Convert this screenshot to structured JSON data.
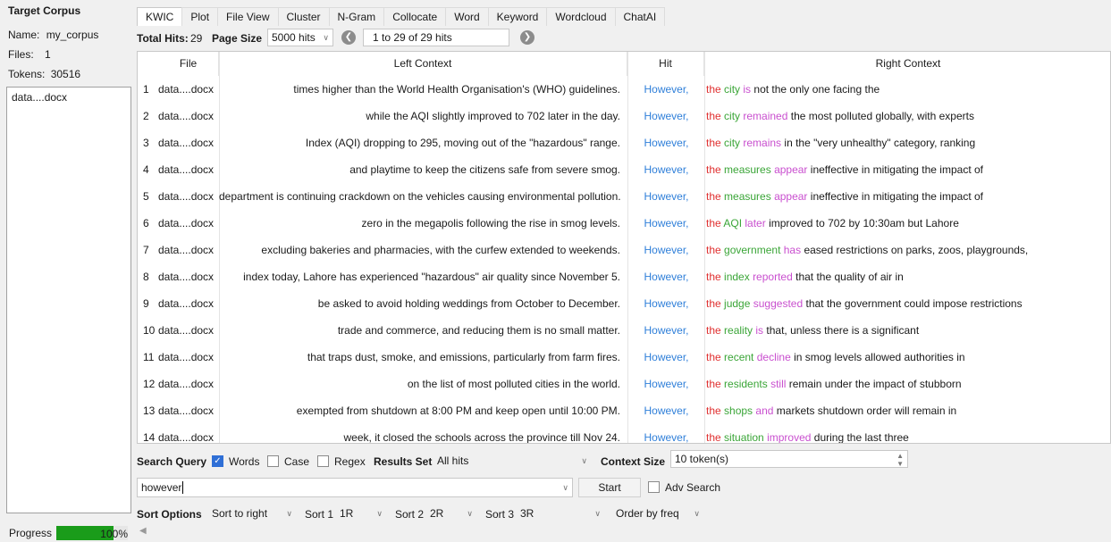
{
  "corpus": {
    "title": "Target Corpus",
    "name_label": "Name:",
    "name_value": "my_corpus",
    "files_label": "Files:",
    "files_value": "1",
    "tokens_label": "Tokens:",
    "tokens_value": "30516",
    "file_list": [
      "data....docx"
    ]
  },
  "tabs": [
    "KWIC",
    "Plot",
    "File View",
    "Cluster",
    "N-Gram",
    "Collocate",
    "Word",
    "Keyword",
    "Wordcloud",
    "ChatAI"
  ],
  "toolbar": {
    "total_hits_label": "Total Hits:",
    "total_hits_value": "29",
    "page_size_label": "Page Size",
    "page_size_value": "5000 hits",
    "range_text": "1 to 29 of 29 hits"
  },
  "table": {
    "columns": [
      "File",
      "Left Context",
      "Hit",
      "Right Context"
    ],
    "rows": [
      {
        "n": "1",
        "file": "data....docx",
        "left": "times higher than the World Health Organisation's (WHO) guidelines.",
        "hit": "However,",
        "r1": "the",
        "r2": "city",
        "r3": "is",
        "rest": "not the only one facing the"
      },
      {
        "n": "2",
        "file": "data....docx",
        "left": "while the AQI slightly improved to 702 later in the day.",
        "hit": "However,",
        "r1": "the",
        "r2": "city",
        "r3": "remained",
        "rest": "the most polluted globally, with experts"
      },
      {
        "n": "3",
        "file": "data....docx",
        "left": "Index (AQI) dropping to 295, moving out of the \"hazardous\" range.",
        "hit": "However,",
        "r1": "the",
        "r2": "city",
        "r3": "remains",
        "rest": "in the \"very unhealthy\" category, ranking"
      },
      {
        "n": "4",
        "file": "data....docx",
        "left": "and playtime to keep the citizens safe from severe smog.",
        "hit": "However,",
        "r1": "the",
        "r2": "measures",
        "r3": "appear",
        "rest": "ineffective in mitigating the impact of"
      },
      {
        "n": "5",
        "file": "data....docx",
        "left": "department is continuing crackdown on the vehicles causing environmental pollution.",
        "hit": "However,",
        "r1": "the",
        "r2": "measures",
        "r3": "appear",
        "rest": "ineffective in mitigating the impact of"
      },
      {
        "n": "6",
        "file": "data....docx",
        "left": "zero in the megapolis following the rise in smog levels.",
        "hit": "However,",
        "r1": "the",
        "r2": "AQI",
        "r3": "later",
        "rest": "improved to 702 by 10:30am but Lahore"
      },
      {
        "n": "7",
        "file": "data....docx",
        "left": "excluding bakeries and pharmacies, with the curfew extended to weekends.",
        "hit": "However,",
        "r1": "the",
        "r2": "government",
        "r3": "has",
        "rest": "eased restrictions on parks, zoos, playgrounds,"
      },
      {
        "n": "8",
        "file": "data....docx",
        "left": "index today, Lahore has experienced \"hazardous\" air quality since November 5.",
        "hit": "However,",
        "r1": "the",
        "r2": "index",
        "r3": "reported",
        "rest": "that the quality of air in"
      },
      {
        "n": "9",
        "file": "data....docx",
        "left": "be asked to avoid holding weddings from October to December.",
        "hit": "However,",
        "r1": "the",
        "r2": "judge",
        "r3": "suggested",
        "rest": "that the government could impose restrictions"
      },
      {
        "n": "10",
        "file": "data....docx",
        "left": "trade and commerce, and reducing them is no small matter.",
        "hit": "However,",
        "r1": "the",
        "r2": "reality",
        "r3": "is",
        "rest": "that, unless there is a significant"
      },
      {
        "n": "11",
        "file": "data....docx",
        "left": "that traps dust, smoke, and emissions, particularly from farm fires.",
        "hit": "However,",
        "r1": "the",
        "r2": "recent",
        "r3": "decline",
        "rest": "in smog levels allowed authorities in"
      },
      {
        "n": "12",
        "file": "data....docx",
        "left": "on the list of most polluted cities in the world.",
        "hit": "However,",
        "r1": "the",
        "r2": "residents",
        "r3": "still",
        "rest": "remain under the impact of stubborn"
      },
      {
        "n": "13",
        "file": "data....docx",
        "left": "exempted from shutdown at 8:00 PM and keep open until 10:00 PM.",
        "hit": "However,",
        "r1": "the",
        "r2": "shops",
        "r3": "and",
        "rest": "markets shutdown order will remain in"
      },
      {
        "n": "14",
        "file": "data....docx",
        "left": "week, it closed the schools across the province till Nov 24.",
        "hit": "However,",
        "r1": "the",
        "r2": "situation",
        "r3": "improved",
        "rest": "during the last three"
      }
    ]
  },
  "search": {
    "query_label": "Search Query",
    "words_label": "Words",
    "case_label": "Case",
    "regex_label": "Regex",
    "results_set_label": "Results Set",
    "results_set_value": "All hits",
    "context_size_label": "Context Size",
    "context_size_value": "10 token(s)",
    "query_value": "however",
    "start_label": "Start",
    "adv_search_label": "Adv Search"
  },
  "sort": {
    "label": "Sort Options",
    "mode_value": "Sort to right",
    "sort1_label": "Sort 1",
    "sort1_value": "1R",
    "sort2_label": "Sort 2",
    "sort2_value": "2R",
    "sort3_label": "Sort 3",
    "sort3_value": "3R",
    "order_value": "Order by freq"
  },
  "status": {
    "progress_label": "Progress",
    "progress_fraction": 1.0,
    "progress_text": "100%"
  },
  "colors": {
    "hit": "#2f7fd9",
    "right_1": "#3aa537",
    "right_2": "#c94fcf",
    "progress": "#1a9c1a",
    "checkbox_on": "#2f6fd6"
  },
  "icons": [
    "prev-page-icon",
    "next-page-icon",
    "dropdown-arrow-icon",
    "spinner-icon",
    "check-icon",
    "scroll-left-icon"
  ]
}
